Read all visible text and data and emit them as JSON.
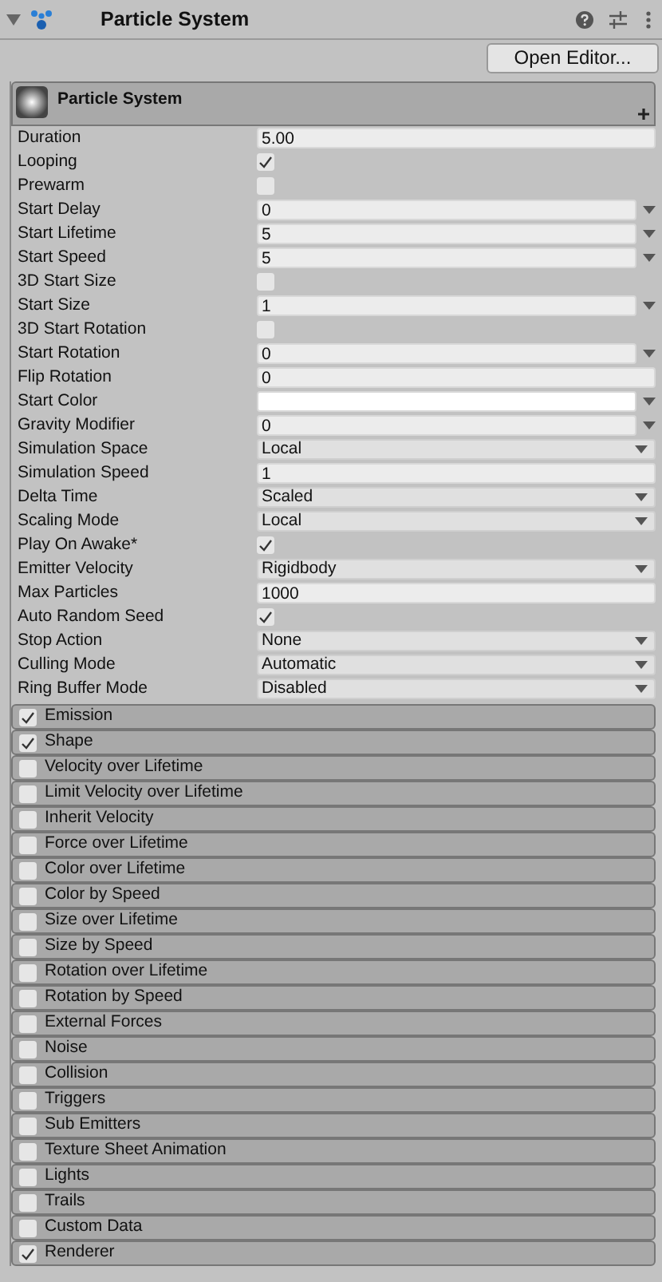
{
  "header": {
    "title": "Particle System",
    "expanded": true
  },
  "open_editor_button": "Open Editor...",
  "module_header": {
    "title": "Particle System"
  },
  "properties": [
    {
      "label": "Duration",
      "kind": "field",
      "value": "5.00"
    },
    {
      "label": "Looping",
      "kind": "check",
      "checked": true
    },
    {
      "label": "Prewarm",
      "kind": "check",
      "checked": false
    },
    {
      "label": "Start Delay",
      "kind": "curve",
      "value": "0"
    },
    {
      "label": "Start Lifetime",
      "kind": "curve",
      "value": "5"
    },
    {
      "label": "Start Speed",
      "kind": "curve",
      "value": "5"
    },
    {
      "label": "3D Start Size",
      "kind": "check",
      "checked": false
    },
    {
      "label": "Start Size",
      "kind": "curve",
      "value": "1"
    },
    {
      "label": "3D Start Rotation",
      "kind": "check",
      "checked": false
    },
    {
      "label": "Start Rotation",
      "kind": "curve",
      "value": "0"
    },
    {
      "label": "Flip Rotation",
      "kind": "field",
      "value": "0"
    },
    {
      "label": "Start Color",
      "kind": "color",
      "color": "#ffffff"
    },
    {
      "label": "Gravity Modifier",
      "kind": "curve",
      "value": "0"
    },
    {
      "label": "Simulation Space",
      "kind": "dropdown",
      "value": "Local"
    },
    {
      "label": "Simulation Speed",
      "kind": "field",
      "value": "1"
    },
    {
      "label": "Delta Time",
      "kind": "dropdown",
      "value": "Scaled"
    },
    {
      "label": "Scaling Mode",
      "kind": "dropdown",
      "value": "Local"
    },
    {
      "label": "Play On Awake*",
      "kind": "check",
      "checked": true
    },
    {
      "label": "Emitter Velocity",
      "kind": "dropdown",
      "value": "Rigidbody"
    },
    {
      "label": "Max Particles",
      "kind": "field",
      "value": "1000"
    },
    {
      "label": "Auto Random Seed",
      "kind": "check",
      "checked": true
    },
    {
      "label": "Stop Action",
      "kind": "dropdown",
      "value": "None"
    },
    {
      "label": "Culling Mode",
      "kind": "dropdown",
      "value": "Automatic"
    },
    {
      "label": "Ring Buffer Mode",
      "kind": "dropdown",
      "value": "Disabled"
    }
  ],
  "modules": [
    {
      "label": "Emission",
      "checked": true
    },
    {
      "label": "Shape",
      "checked": true
    },
    {
      "label": "Velocity over Lifetime",
      "checked": false
    },
    {
      "label": "Limit Velocity over Lifetime",
      "checked": false
    },
    {
      "label": "Inherit Velocity",
      "checked": false
    },
    {
      "label": "Force over Lifetime",
      "checked": false
    },
    {
      "label": "Color over Lifetime",
      "checked": false
    },
    {
      "label": "Color by Speed",
      "checked": false
    },
    {
      "label": "Size over Lifetime",
      "checked": false
    },
    {
      "label": "Size by Speed",
      "checked": false
    },
    {
      "label": "Rotation over Lifetime",
      "checked": false
    },
    {
      "label": "Rotation by Speed",
      "checked": false
    },
    {
      "label": "External Forces",
      "checked": false
    },
    {
      "label": "Noise",
      "checked": false
    },
    {
      "label": "Collision",
      "checked": false
    },
    {
      "label": "Triggers",
      "checked": false
    },
    {
      "label": "Sub Emitters",
      "checked": false
    },
    {
      "label": "Texture Sheet Animation",
      "checked": false
    },
    {
      "label": "Lights",
      "checked": false
    },
    {
      "label": "Trails",
      "checked": false
    },
    {
      "label": "Custom Data",
      "checked": false
    },
    {
      "label": "Renderer",
      "checked": true
    }
  ]
}
